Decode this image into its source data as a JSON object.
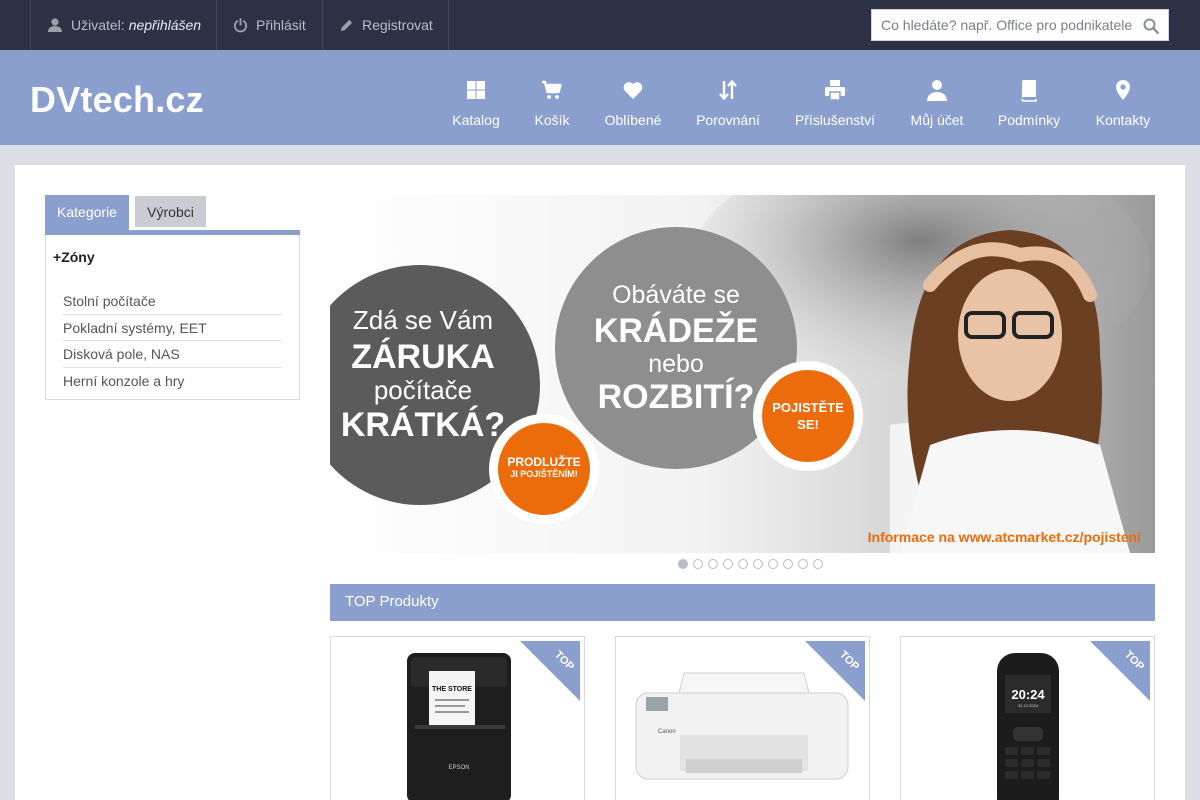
{
  "topbar": {
    "user_label": "Uživatel:",
    "user_status": "nepřihlášen",
    "login_label": "Přihlásit",
    "register_label": "Registrovat",
    "search_placeholder": "Co hledáte? např. Office pro podnikatele"
  },
  "header": {
    "logo": "DVtech.cz",
    "nav": [
      {
        "label": "Katalog",
        "icon": "grid-icon"
      },
      {
        "label": "Košík",
        "icon": "cart-icon"
      },
      {
        "label": "Oblíbené",
        "icon": "heart-icon"
      },
      {
        "label": "Porovnání",
        "icon": "compare-arrows-icon"
      },
      {
        "label": "Příslušenství",
        "icon": "printer-icon"
      },
      {
        "label": "Můj účet",
        "icon": "user-icon"
      },
      {
        "label": "Podmínky",
        "icon": "book-icon"
      },
      {
        "label": "Kontakty",
        "icon": "map-pin-icon"
      }
    ]
  },
  "sidebar": {
    "tabs": [
      {
        "label": "Kategorie",
        "active": true
      },
      {
        "label": "Výrobci",
        "active": false
      }
    ],
    "category_group": "Zóny",
    "categories": [
      "Stolní počítače",
      "Pokladní systémy, EET",
      "Disková pole, NAS",
      "Herní konzole a hry"
    ]
  },
  "banner": {
    "circle1": {
      "line1": "Zdá se Vám",
      "line2": "ZÁRUKA",
      "line3": "počítače",
      "line4": "KRÁTKÁ?"
    },
    "badge1": {
      "line1": "PRODLUŽTE",
      "line2": "JI POJIŠTĚNÍM!"
    },
    "circle2": {
      "line1": "Obáváte se",
      "line2": "KRÁDEŽE",
      "line3": "nebo",
      "line4": "ROZBITÍ?"
    },
    "badge2": {
      "line1": "POJISTĚTE",
      "line2": "SE!"
    },
    "footer_text": "Informace na www.atcmarket.cz/pojisteni",
    "slide_count": 10,
    "active_slide": 1
  },
  "products_section": {
    "title": "TOP Produkty",
    "ribbon_label": "TOP",
    "products": [
      {
        "name": "receipt-printer-image",
        "screen_text": "THE STORE",
        "brand_text": "EPSON"
      },
      {
        "name": "inkjet-printer-image",
        "brand_text": "Canon"
      },
      {
        "name": "mobile-phone-image",
        "screen_time": "20:24",
        "screen_date": "31.12.2024"
      }
    ]
  },
  "colors": {
    "topbar_bg": "#2c3244",
    "accent": "#8a9fcd",
    "banner_orange": "#ec6c0b"
  }
}
